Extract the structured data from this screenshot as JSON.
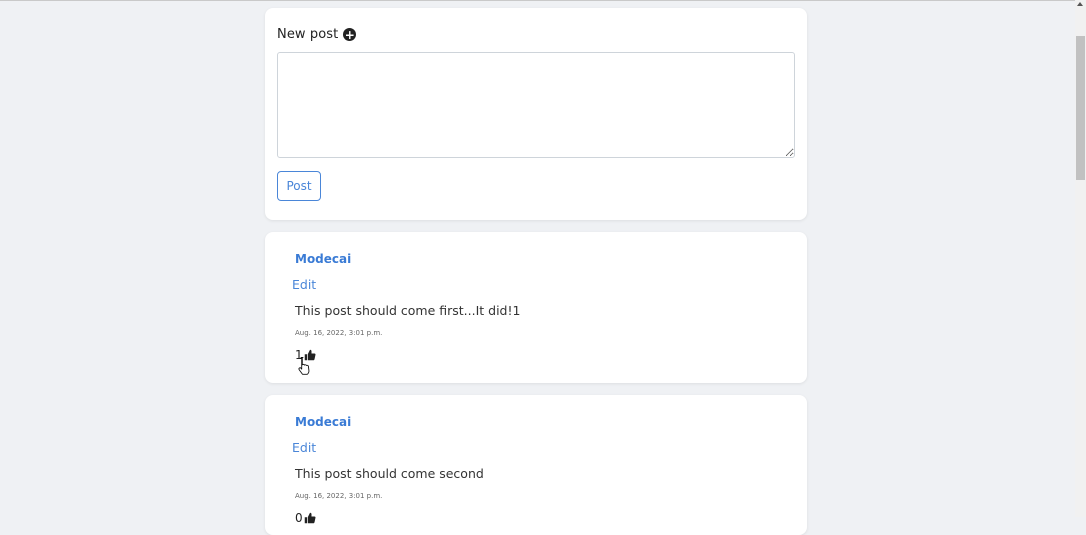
{
  "new_post": {
    "title": "New post",
    "icon": "plus-circle-icon",
    "textarea_value": "",
    "button_label": "Post"
  },
  "posts": [
    {
      "author": "Modecai",
      "edit_label": "Edit",
      "body": "This post should come first...It did!1",
      "timestamp": "Aug. 16, 2022, 3:01 p.m.",
      "likes": "1"
    },
    {
      "author": "Modecai",
      "edit_label": "Edit",
      "body": "This post should come second",
      "timestamp": "Aug. 16, 2022, 3:01 p.m.",
      "likes": "0"
    }
  ],
  "colors": {
    "background": "#eff1f4",
    "accent": "#4a86d8",
    "author": "#3a7bd5"
  }
}
